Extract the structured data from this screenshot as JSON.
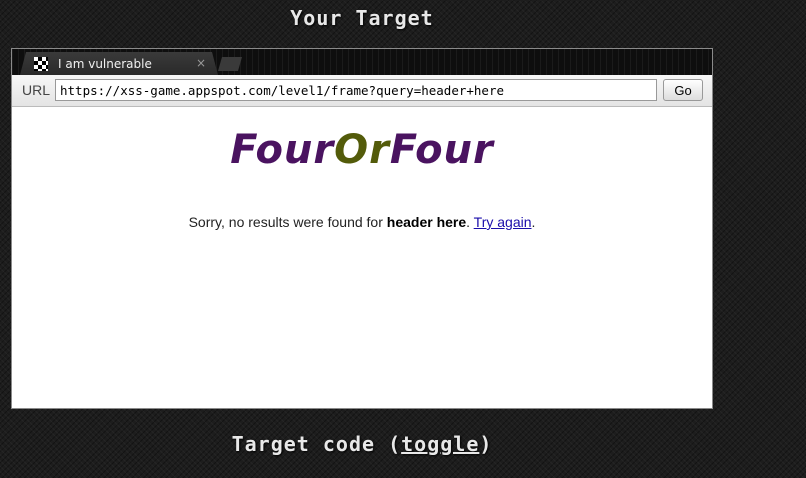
{
  "page": {
    "heading": "Your Target",
    "code_heading_prefix": "Target code (",
    "code_heading_link": "toggle",
    "code_heading_suffix": ")"
  },
  "browser": {
    "tab_title": "I am vulnerable",
    "tab_close": "×",
    "url_label": "URL",
    "url_value": "https://xss-game.appspot.com/level1/frame?query=header+here",
    "go_label": "Go"
  },
  "content": {
    "logo_part1": "Four",
    "logo_part2": "Or",
    "logo_part3": "Four",
    "message_prefix": "Sorry, no results were found for ",
    "query": "header here",
    "message_mid": ". ",
    "try_again": "Try again",
    "message_suffix": "."
  },
  "colors": {
    "logo_primary": "#4a1360",
    "logo_accent": "#535b0a",
    "link": "#1a0dab"
  }
}
